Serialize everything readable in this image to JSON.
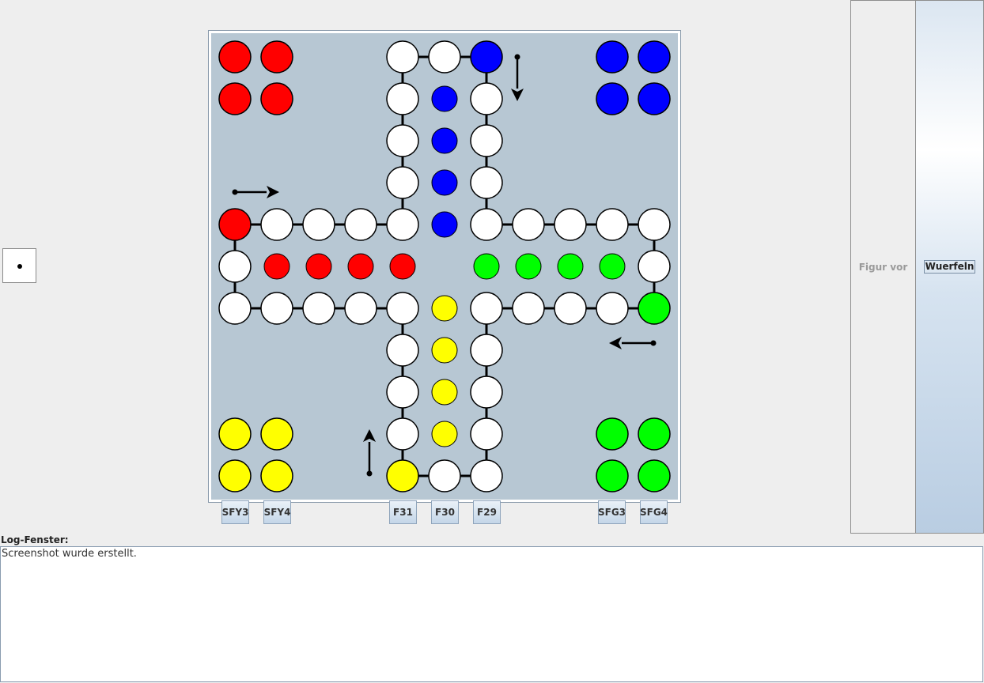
{
  "die": {
    "value": 1
  },
  "board": {
    "colors": {
      "red": "#ff0000",
      "blue": "#0000ff",
      "green": "#00ff00",
      "yellow": "#ffff00",
      "empty": "#ffffff",
      "board_bg": "#b7c7d3"
    },
    "red_home": [
      "red",
      "red",
      "red",
      "red"
    ],
    "blue_home": [
      "blue",
      "blue",
      "blue",
      "blue"
    ],
    "yellow_home": [
      "yellow",
      "yellow",
      "yellow",
      "yellow"
    ],
    "green_home": [
      "green",
      "green",
      "green",
      "green"
    ],
    "red_goal": [
      "red",
      "red",
      "red",
      "red"
    ],
    "blue_goal": [
      "blue",
      "blue",
      "blue",
      "blue"
    ],
    "green_goal": [
      "green",
      "green",
      "green",
      "green"
    ],
    "yellow_goal": [
      "yellow",
      "yellow",
      "yellow",
      "yellow"
    ],
    "occupied_track": {
      "red_start": "red",
      "blue_start": "blue",
      "green_start": "green",
      "yellow_start": "yellow"
    },
    "entry_arrows": [
      "arrow-right",
      "arrow-down",
      "arrow-left",
      "arrow-up"
    ]
  },
  "field_buttons": [
    "SFY3",
    "SFY4",
    "F31",
    "F30",
    "F29",
    "SFG3",
    "SFG4"
  ],
  "side_panel": {
    "figur_vor_label": "Figur vor",
    "wuerfeln_label": "Wuerfeln"
  },
  "log": {
    "label": "Log-Fenster:",
    "text": "Screenshot wurde erstellt."
  }
}
